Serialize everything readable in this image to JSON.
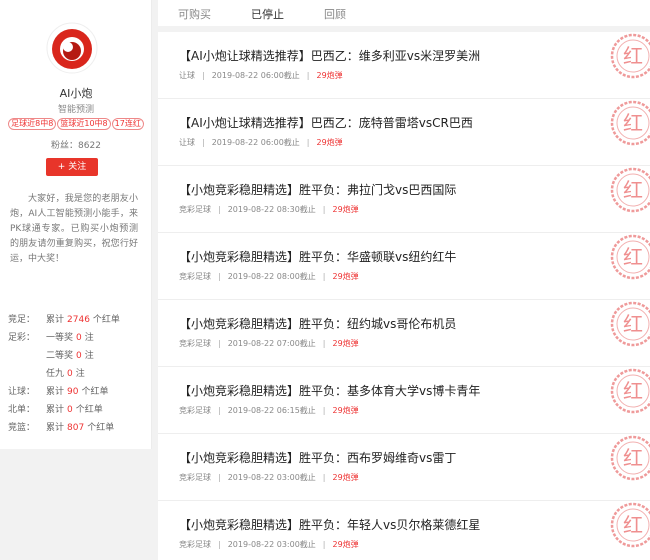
{
  "sidebar": {
    "name": "AI小炮",
    "subtitle": "智能预测",
    "badges": [
      "足球近8中8",
      "篮球近10中8",
      "17连红"
    ],
    "fans_label": "粉丝：",
    "fans_count": "8622",
    "follow_label": "+ 关注",
    "intro": "大家好，我是您的老朋友小炮，AI人工智能预测小能手，来PK球通专家。已购买小炮预测的朋友请勿重复购买，祝您行好运，中大奖！",
    "stats": [
      {
        "label": "竞足：",
        "prefix": "累计",
        "num": "2746",
        "suffix": "个红单"
      },
      {
        "label": "足彩：",
        "prefix": "一等奖",
        "num": "0",
        "suffix": "注"
      },
      {
        "label": "",
        "prefix": "二等奖",
        "num": "0",
        "suffix": "注"
      },
      {
        "label": "",
        "prefix": "任九",
        "num": "0",
        "suffix": "注"
      },
      {
        "label": "让球：",
        "prefix": "累计",
        "num": "90",
        "suffix": "个红单"
      },
      {
        "label": "北单：",
        "prefix": "累计",
        "num": "0",
        "suffix": "个红单"
      },
      {
        "label": "竞篮：",
        "prefix": "累计",
        "num": "807",
        "suffix": "个红单"
      }
    ]
  },
  "tabs": [
    "可购买",
    "已停止",
    "回顾"
  ],
  "active_tab": 1,
  "stamp_char": "红",
  "items": [
    {
      "title": "【AI小炮让球精选推荐】巴西乙：维多利亚vs米涅罗美洲",
      "category": "让球",
      "time": "2019-08-22 06:00截止",
      "price": "29炮弹"
    },
    {
      "title": "【AI小炮让球精选推荐】巴西乙：庞特普雷塔vsCR巴西",
      "category": "让球",
      "time": "2019-08-22 06:00截止",
      "price": "29炮弹"
    },
    {
      "title": "【小炮竞彩稳胆精选】胜平负：弗拉门戈vs巴西国际",
      "category": "竞彩足球",
      "time": "2019-08-22 08:30截止",
      "price": "29炮弹"
    },
    {
      "title": "【小炮竞彩稳胆精选】胜平负：华盛顿联vs纽约红牛",
      "category": "竞彩足球",
      "time": "2019-08-22 08:00截止",
      "price": "29炮弹"
    },
    {
      "title": "【小炮竞彩稳胆精选】胜平负：纽约城vs哥伦布机员",
      "category": "竞彩足球",
      "time": "2019-08-22 07:00截止",
      "price": "29炮弹"
    },
    {
      "title": "【小炮竞彩稳胆精选】胜平负：基多体育大学vs博卡青年",
      "category": "竞彩足球",
      "time": "2019-08-22 06:15截止",
      "price": "29炮弹"
    },
    {
      "title": "【小炮竞彩稳胆精选】胜平负：西布罗姆维奇vs雷丁",
      "category": "竞彩足球",
      "time": "2019-08-22 03:00截止",
      "price": "29炮弹"
    },
    {
      "title": "【小炮竞彩稳胆精选】胜平负：年轻人vs贝尔格莱德红星",
      "category": "竞彩足球",
      "time": "2019-08-22 03:00截止",
      "price": "29炮弹"
    }
  ]
}
